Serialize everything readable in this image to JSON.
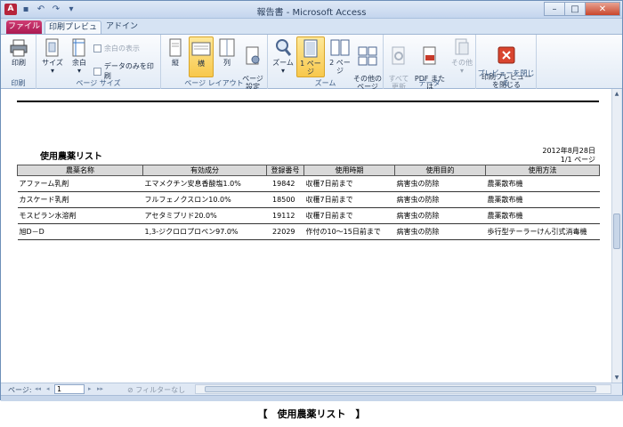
{
  "window": {
    "title": "報告書 - Microsoft Access",
    "app_icon": "A",
    "controls": {
      "minimize": "–",
      "maximize": "□",
      "close": "✕"
    }
  },
  "tabs": [
    {
      "label": "ファイル"
    },
    {
      "label": "印刷プレビュー"
    },
    {
      "label": "アドイン"
    }
  ],
  "ribbon": {
    "print": {
      "print_label": "印刷",
      "group_label": "印刷"
    },
    "page_size": {
      "size_label": "サイズ",
      "margins_label": "余白",
      "show_margins_label": "余白の表示",
      "print_data_only_label": "データのみを印刷",
      "group_label": "ページ サイズ"
    },
    "page_layout": {
      "portrait_label": "縦",
      "landscape_label": "横",
      "columns_label": "列",
      "page_setup_label": "ページ\n設定",
      "group_label": "ページ レイアウト"
    },
    "zoom": {
      "zoom_label": "ズーム",
      "one_page_label": "1 ページ",
      "two_pages_label": "2 ページ",
      "more_pages_label": "その他の\nページ",
      "group_label": "ズーム"
    },
    "data": {
      "refresh_all_label": "すべて\n更新",
      "pdf_xps_label": "PDF または\nXPS",
      "more_label": "その他",
      "group_label": "データ"
    },
    "close_preview": {
      "close_label": "印刷プレビュー\nを閉じる",
      "group_label": "プレビューを閉じる"
    }
  },
  "report": {
    "title": "使用農薬リスト",
    "date": "2012年8月28日",
    "page": "1/1 ページ",
    "columns": [
      "農薬名称",
      "有効成分",
      "登録番号",
      "使用時期",
      "使用目的",
      "使用方法"
    ],
    "rows": [
      [
        "アファーム乳剤",
        "エマメクチン安息香酸塩1.0%",
        "19842",
        "収穫7日前まで",
        "病害虫の防除",
        "農薬散布機"
      ],
      [
        "カスケード乳剤",
        "フルフェノクスロン10.0%",
        "18500",
        "収穫7日前まで",
        "病害虫の防除",
        "農薬散布機"
      ],
      [
        "モスピラン水溶剤",
        "アセタミプリド20.0%",
        "19112",
        "収穫7日前まで",
        "病害虫の防除",
        "農薬散布機"
      ],
      [
        "旭D－D",
        "1,3-ジクロロプロペン97.0%",
        "22029",
        "作付の10～15日前まで",
        "病害虫の防除",
        "歩行型テーラーけん引式消毒機"
      ]
    ]
  },
  "navigation": {
    "page_label": "ページ:",
    "first": "◂◂",
    "prev": "◂",
    "current_page": "1",
    "next": "▸",
    "last": "▸▸",
    "filter_label": "フィルターなし"
  },
  "caption": "【　使用農薬リスト　】",
  "colors": {
    "file_tab": "#b8205a",
    "active_button": "#f8c84c",
    "close_button": "#c9462c",
    "header_fill": "#d9d9d9"
  }
}
